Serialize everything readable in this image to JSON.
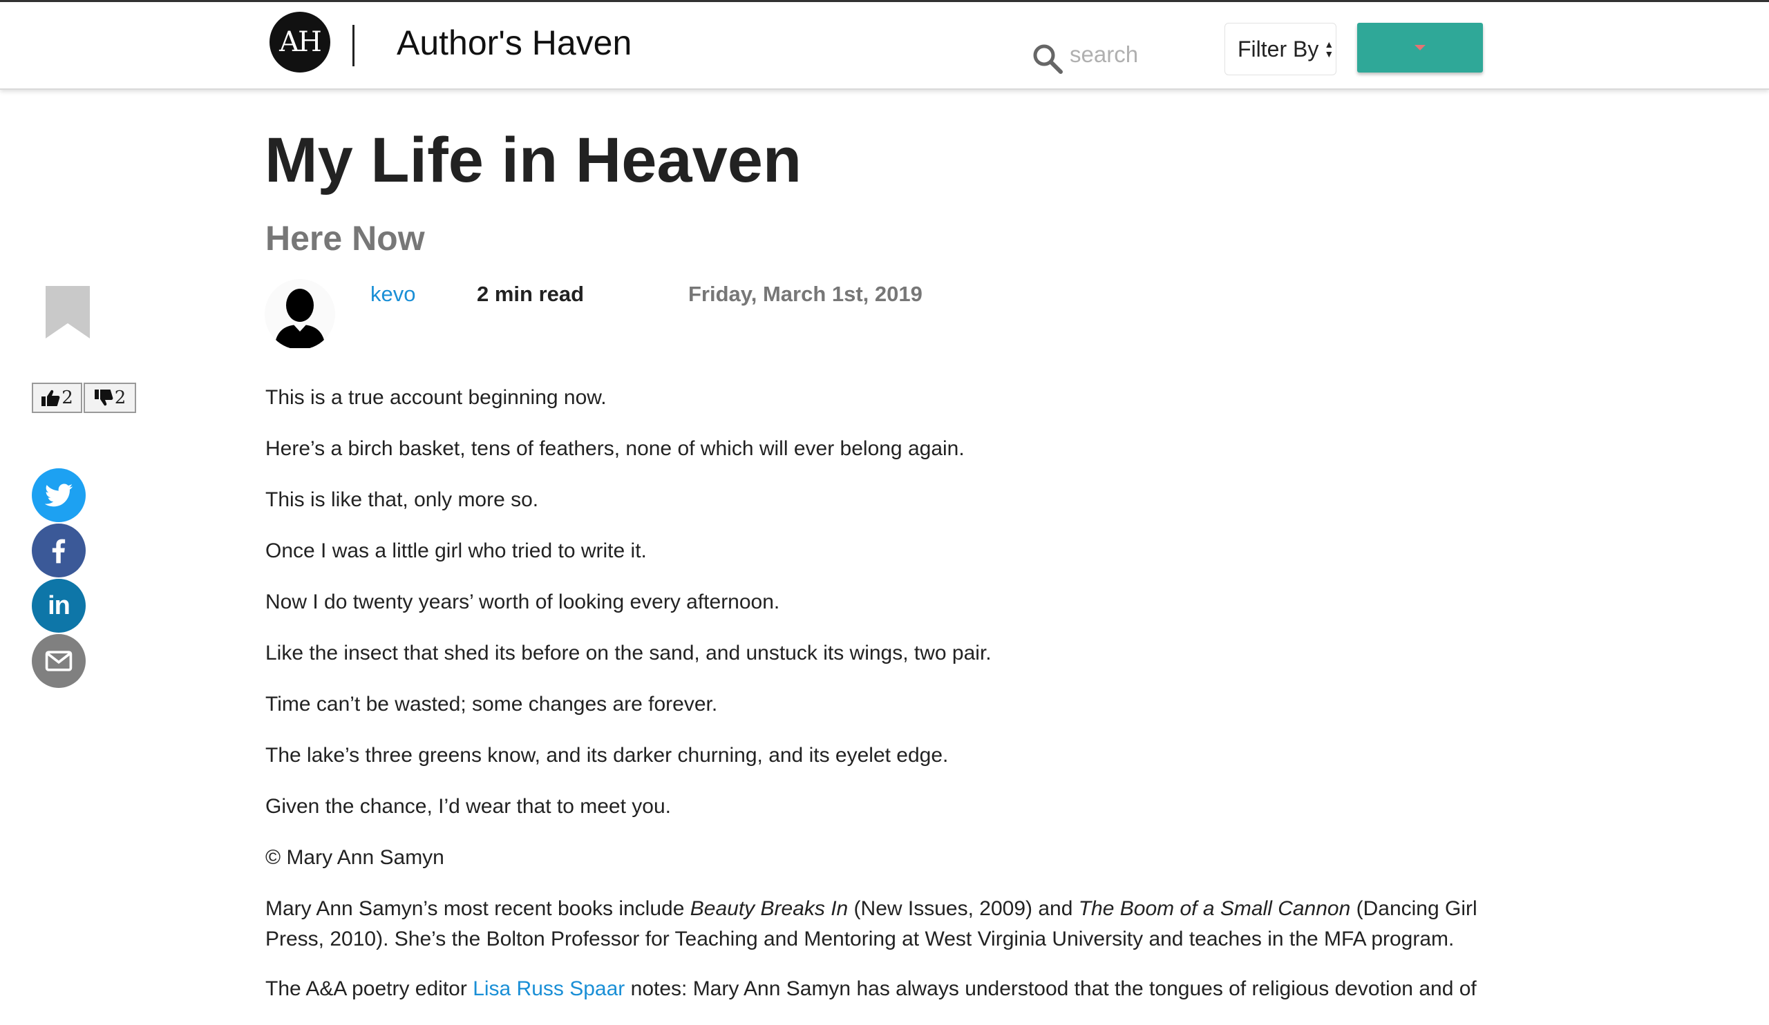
{
  "header": {
    "logo_text": "AH",
    "brand": "Author's Haven",
    "search_placeholder": "search",
    "filter_label": "Filter By"
  },
  "colors": {
    "accent": "#2fa898",
    "link": "#1a8fd6",
    "twitter": "#1da1f2",
    "facebook": "#3b5998",
    "linkedin": "#0e76a8",
    "email": "#808080"
  },
  "article": {
    "title": "My Life in Heaven",
    "subtitle": "Here Now",
    "author": "kevo",
    "read_time": "2 min read",
    "date": "Friday, March 1st, 2019",
    "paragraphs": [
      "This is a true account beginning now.",
      "Here’s a birch basket, tens of feathers, none of which will ever belong again.",
      "This is like that, only more so.",
      "Once I was a little girl who tried to write it.",
      "Now I do twenty years’ worth of looking every afternoon.",
      "Like the insect that shed its before on the sand, and unstuck its wings, two pair.",
      "Time can’t be wasted; some changes are forever.",
      "The lake’s three greens know, and its darker churning, and its eyelet edge.",
      "Given the chance, I’d wear that to meet you.",
      "© Mary Ann Samyn"
    ],
    "bio": {
      "part1": "Mary Ann Samyn’s most recent books include ",
      "book1": "Beauty Breaks In",
      "part2": " (New Issues, 2009) and ",
      "book2": "The Boom of a Small Cannon",
      "part3": " (Dancing Girl Press, 2010). She’s the Bolton Professor for Teaching and Mentoring at West Virginia University and teaches in the MFA program."
    },
    "editor_note": {
      "part1": "The A&A poetry editor ",
      "link": "Lisa Russ Spaar",
      "part2": " notes: Mary Ann Samyn has always understood that the tongues of religious devotion and of"
    }
  },
  "sidebar": {
    "likes": "2",
    "dislikes": "2",
    "share_icons": [
      "twitter-icon",
      "facebook-icon",
      "linkedin-icon",
      "email-icon"
    ]
  }
}
